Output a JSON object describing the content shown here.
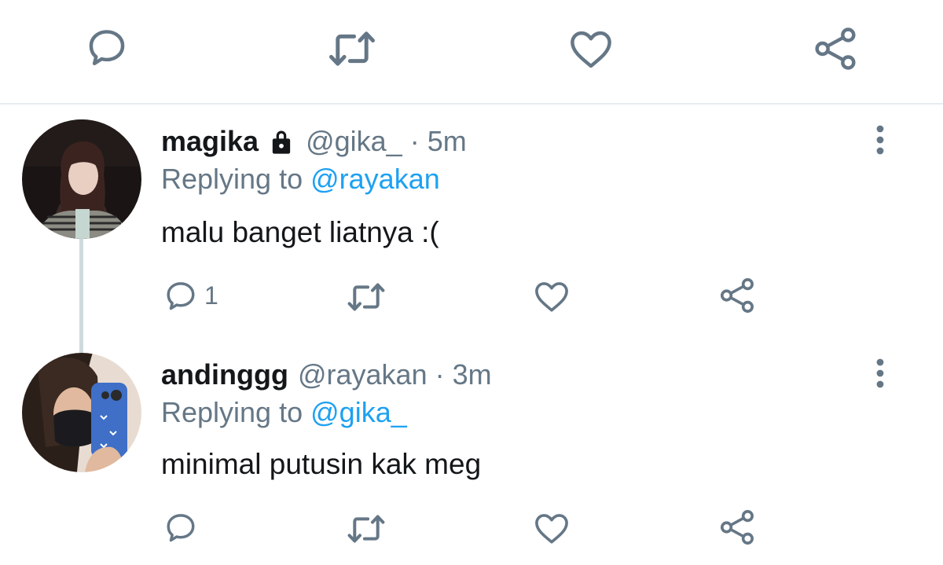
{
  "icons": {
    "reply": "reply-icon",
    "retweet": "retweet-icon",
    "like": "like-icon",
    "share": "share-icon",
    "lock": "lock-icon",
    "more": "more-vertical-icon"
  },
  "colors": {
    "text": "#14171a",
    "secondary": "#657786",
    "accent": "#1da1f2",
    "divider": "#e6ecf0",
    "thread_line": "#cfd9de"
  },
  "tweets": [
    {
      "name": "magika",
      "protected": true,
      "handle": "@gika_",
      "separator": "·",
      "time": "5m",
      "replying_prefix": "Replying to",
      "replying_to": "@rayakan",
      "text": "malu banget liatnya :(",
      "reply_count": "1"
    },
    {
      "name": "andinggg",
      "protected": false,
      "handle": "@rayakan",
      "separator": "·",
      "time": "3m",
      "replying_prefix": "Replying to",
      "replying_to": "@gika_",
      "text": "minimal putusin kak meg",
      "reply_count": ""
    }
  ]
}
